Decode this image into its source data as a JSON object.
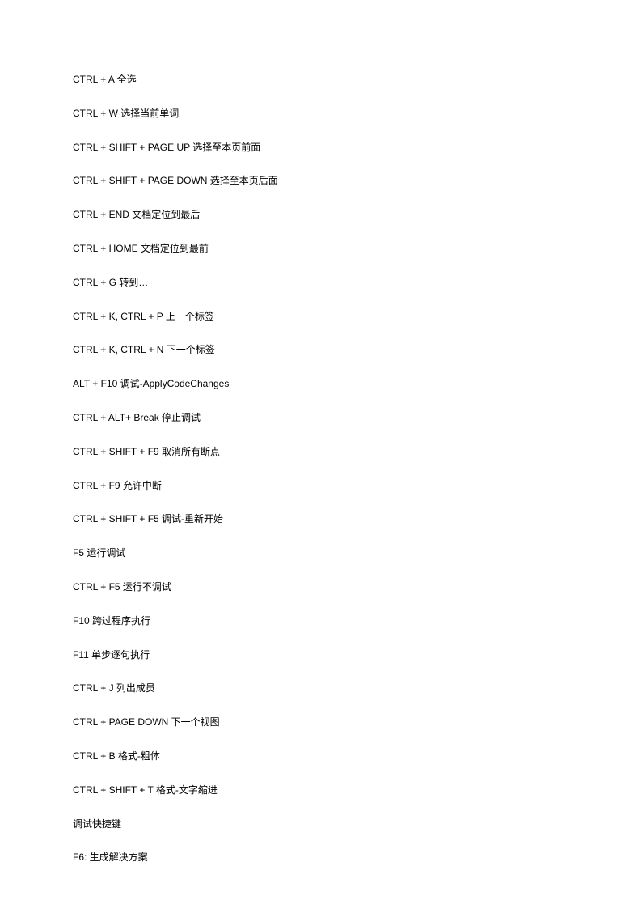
{
  "lines": [
    "CTRL + A 全选",
    "CTRL + W 选择当前单词",
    "CTRL + SHIFT + PAGE UP 选择至本页前面",
    "CTRL + SHIFT + PAGE DOWN 选择至本页后面",
    "CTRL + END 文档定位到最后",
    "CTRL + HOME 文档定位到最前",
    "CTRL + G 转到…",
    "CTRL + K, CTRL + P 上一个标签",
    "CTRL + K, CTRL + N 下一个标签",
    "ALT + F10 调试-ApplyCodeChanges",
    "CTRL + ALT+ Break 停止调试",
    "CTRL + SHIFT + F9  取消所有断点",
    "CTRL + F9 允许中断",
    "CTRL + SHIFT + F5 调试-重新开始",
    "F5 运行调试",
    "CTRL + F5 运行不调试",
    "F10 跨过程序执行",
    "F11 单步逐句执行",
    "CTRL + J 列出成员",
    "CTRL + PAGE DOWN 下一个视图",
    "CTRL + B 格式-粗体",
    "CTRL + SHIFT + T 格式-文字缩进",
    "调试快捷键",
    "F6:  生成解决方案"
  ]
}
